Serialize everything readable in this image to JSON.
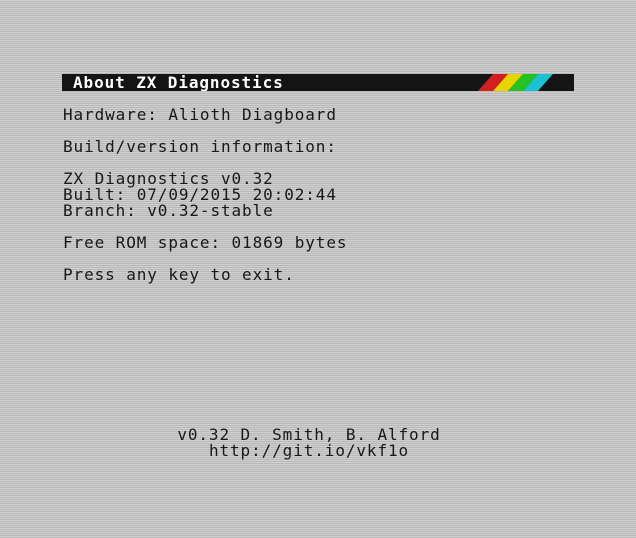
{
  "title_bar": {
    "title": "About ZX Diagnostics",
    "stripe_colors": [
      "#d12020",
      "#e8d400",
      "#22c322",
      "#1cc2d2"
    ]
  },
  "info": {
    "hardware": "Hardware: Alioth Diagboard",
    "build_heading": "Build/version information:",
    "version": "ZX Diagnostics v0.32",
    "built": "Built: 07/09/2015 20:02:44",
    "branch": "Branch: v0.32-stable",
    "free_rom": "Free ROM space: 01869 bytes",
    "exit_prompt": "Press any key to exit."
  },
  "footer": {
    "credits": "v0.32 D. Smith, B. Alford",
    "url": "http://git.io/vkf1o"
  }
}
